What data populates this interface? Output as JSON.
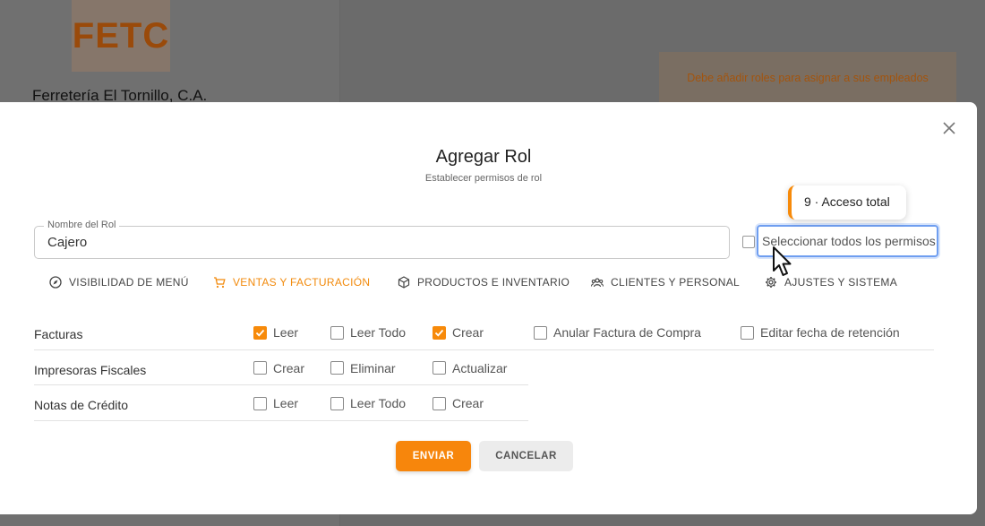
{
  "background": {
    "logo_text": "FETC",
    "company_name": "Ferretería El Tornillo, C.A.",
    "alert_text": "Debe añadir roles para asignar a sus empleados"
  },
  "modal": {
    "title": "Agregar Rol",
    "subtitle": "Establecer permisos de rol",
    "close_icon": "close-icon"
  },
  "role_name": {
    "label": "Nombre del Rol",
    "value": "Cajero"
  },
  "select_all": {
    "label": "Seleccionar todos los permisos",
    "checked": false
  },
  "tooltip": {
    "text": "9 · Acceso total"
  },
  "tabs": [
    {
      "label": "VISIBILIDAD DE MENÚ",
      "icon": "compass-icon",
      "active": false
    },
    {
      "label": "VENTAS Y FACTURACIÓN",
      "icon": "cart-icon",
      "active": true
    },
    {
      "label": "PRODUCTOS E INVENTARIO",
      "icon": "box-icon",
      "active": false
    },
    {
      "label": "CLIENTES Y PERSONAL",
      "icon": "people-icon",
      "active": false
    },
    {
      "label": "AJUSTES Y SISTEMA",
      "icon": "gear-icon",
      "active": false
    }
  ],
  "permissions": [
    {
      "name": "Facturas",
      "options": [
        {
          "label": "Leer",
          "checked": true
        },
        {
          "label": "Leer Todo",
          "checked": false
        },
        {
          "label": "Crear",
          "checked": true
        },
        {
          "label": "Anular Factura de Compra",
          "checked": false
        },
        {
          "label": "Editar fecha de retención",
          "checked": false
        }
      ]
    },
    {
      "name": "Impresoras Fiscales",
      "options": [
        {
          "label": "Crear",
          "checked": false
        },
        {
          "label": "Eliminar",
          "checked": false
        },
        {
          "label": "Actualizar",
          "checked": false
        }
      ]
    },
    {
      "name": "Notas de Crédito",
      "options": [
        {
          "label": "Leer",
          "checked": false
        },
        {
          "label": "Leer Todo",
          "checked": false
        },
        {
          "label": "Crear",
          "checked": false
        }
      ]
    }
  ],
  "buttons": {
    "send": "ENVIAR",
    "cancel": "CANCELAR"
  },
  "colors": {
    "accent": "#f7860c",
    "focus": "#6f9ef0"
  }
}
